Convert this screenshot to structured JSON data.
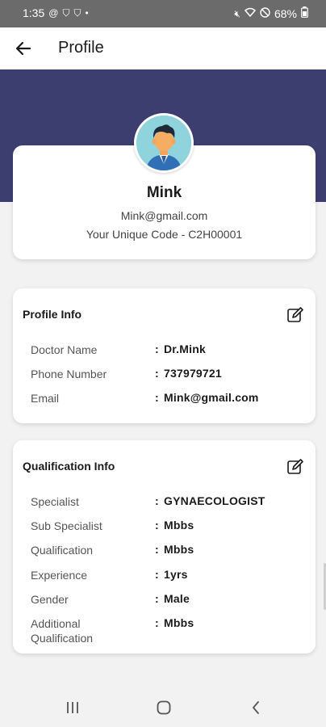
{
  "status_bar": {
    "time": "1:35",
    "battery": "68%",
    "left_icons": [
      "at-icon",
      "shield-icon",
      "shield-icon",
      "dot-icon"
    ],
    "right_icons": [
      "mute-icon",
      "wifi-icon",
      "dnd-icon",
      "battery-icon"
    ]
  },
  "app_bar": {
    "title": "Profile"
  },
  "profile": {
    "name": "Mink",
    "email": "Mink@gmail.com",
    "unique_code": "Your Unique Code - C2H00001"
  },
  "profile_info": {
    "heading": "Profile Info",
    "rows": [
      {
        "label": "Doctor Name",
        "colon": ":",
        "value": "Dr.Mink"
      },
      {
        "label": "Phone Number",
        "colon": ":",
        "value": "737979721"
      },
      {
        "label": "Email",
        "colon": ":",
        "value": "Mink@gmail.com"
      }
    ]
  },
  "qualification_info": {
    "heading": "Qualification Info",
    "rows": [
      {
        "label": "Specialist",
        "colon": ":",
        "value": "GYNAECOLOGIST"
      },
      {
        "label": "Sub Specialist",
        "colon": ":",
        "value": "Mbbs"
      },
      {
        "label": "Qualification",
        "colon": ":",
        "value": "Mbbs"
      },
      {
        "label": "Experience",
        "colon": ":",
        "value": "1yrs"
      },
      {
        "label": "Gender",
        "colon": ":",
        "value": "Male"
      },
      {
        "label": "Additional Qualification",
        "colon": ":",
        "value": "Mbbs"
      }
    ]
  },
  "colors": {
    "hero": "#3d3e70",
    "background": "#f2f2f2",
    "status_bar": "#6b6b6b",
    "avatar_bg": "#8fd3dc"
  }
}
